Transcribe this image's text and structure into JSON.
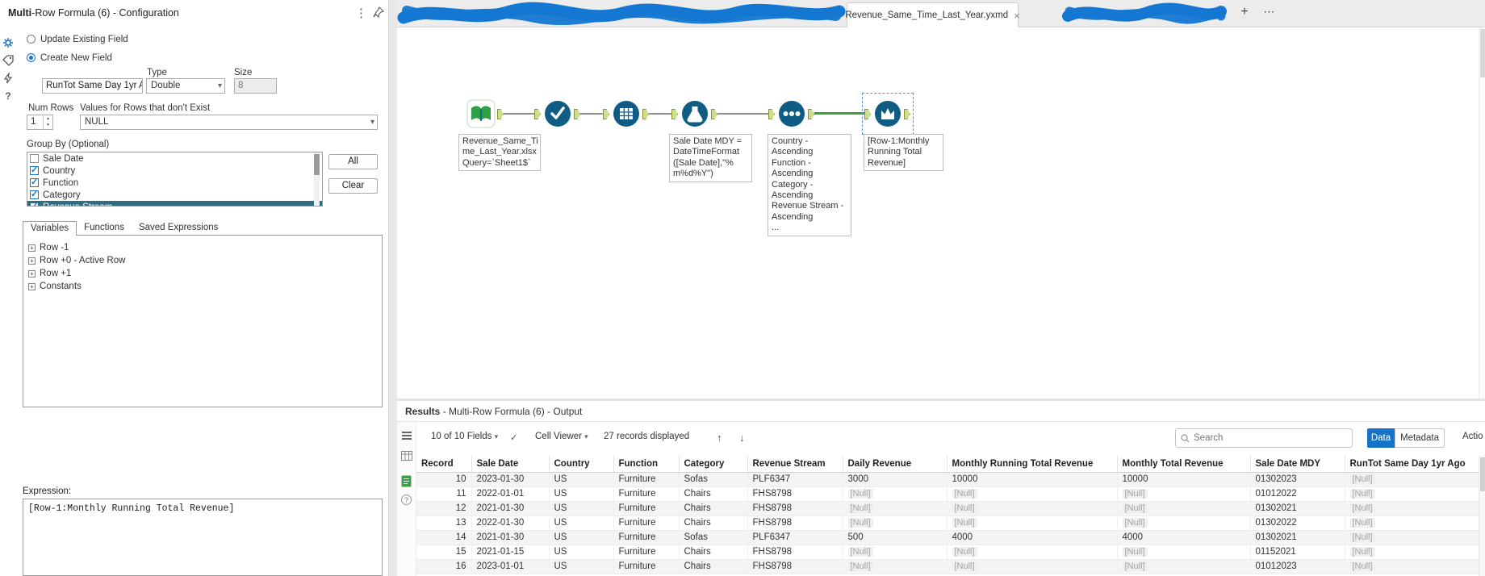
{
  "icons": {
    "kebab": "⋮",
    "caret": "▾",
    "close": "×",
    "add": "+",
    "more": "⋯",
    "up": "↑",
    "down": "↓",
    "check": "✓",
    "question": "?",
    "expand": "+",
    "spin_up": "▲",
    "spin_down": "▼"
  },
  "colors": {
    "accent_blue": "#1673c8",
    "tool_circle": "#0f5c84",
    "anchor_green": "#cdde8f",
    "connection_green": "#3da23d",
    "redaction_blue": "#1478d2"
  },
  "config": {
    "title_bold": "Multi",
    "title_rest": "-Row Formula (6) - Configuration",
    "radio_update": "Update Existing Field",
    "radio_create": "Create New  Field",
    "field_value": "RunTot Same Day 1yr A",
    "type_label": "Type",
    "type_value": "Double",
    "size_label": "Size",
    "size_value": "8",
    "num_rows_label": "Num Rows",
    "num_rows_value": "1",
    "values_label": "Values for Rows that don't Exist",
    "values_value": "NULL",
    "group_by": {
      "label": "Group By (Optional)",
      "items": [
        {
          "label": "Sale Date",
          "checked": false
        },
        {
          "label": "Country",
          "checked": true
        },
        {
          "label": "Function",
          "checked": true
        },
        {
          "label": "Category",
          "checked": true
        },
        {
          "label": "Revenue Stream",
          "checked": true
        }
      ],
      "all": "All",
      "clear": "Clear"
    },
    "tabs": [
      {
        "label": "Variables"
      },
      {
        "label": "Functions"
      },
      {
        "label": "Saved Expressions"
      }
    ],
    "variables_tree": [
      "Row -1",
      "Row +0 - Active Row",
      "Row +1",
      "Constants"
    ],
    "expression_label": "Expression:",
    "expression_value": "[Row-1:Monthly Running Total Revenue]"
  },
  "workflow_tabs": {
    "active": "Revenue_Same_Time_Last_Year.yxmd"
  },
  "canvas": {
    "tools": [
      {
        "id": "input-data",
        "annotation": "Revenue_Same_Ti\nme_Last_Year.xlsx\nQuery=`Sheet1$`"
      },
      {
        "id": "select",
        "annotation": ""
      },
      {
        "id": "datetime",
        "annotation": ""
      },
      {
        "id": "formula",
        "annotation": "Sale Date MDY =\nDateTimeFormat\n([Sale Date],\"%\nm%d%Y\")"
      },
      {
        "id": "sort",
        "annotation": "Country -\nAscending\nFunction -\nAscending\nCategory -\nAscending\nRevenue Stream -\nAscending\n..."
      },
      {
        "id": "multi-row-formula",
        "annotation": "[Row-1:Monthly\nRunning Total\nRevenue]"
      }
    ]
  },
  "results": {
    "title_bold": "Results",
    "title_rest": " - Multi-Row Formula (6) - Output",
    "toolbar": {
      "fields": "10 of 10 Fields",
      "cell_viewer": "Cell Viewer",
      "records": "27 records displayed",
      "search_placeholder": "Search",
      "data": "Data",
      "metadata": "Metadata",
      "actions": "Actio"
    },
    "columns": [
      "Record",
      "Sale Date",
      "Country",
      "Function",
      "Category",
      "Revenue Stream",
      "Daily Revenue",
      "Monthly Running Total Revenue",
      "Monthly Total Revenue",
      "Sale Date MDY",
      "RunTot Same Day 1yr Ago"
    ],
    "rows": [
      [
        "10",
        "2023-01-30",
        "US",
        "Furniture",
        "Sofas",
        "PLF6347",
        "3000",
        "10000",
        "10000",
        "01302023",
        "[Null]"
      ],
      [
        "11",
        "2022-01-01",
        "US",
        "Furniture",
        "Chairs",
        "FHS8798",
        "[Null]",
        "[Null]",
        "[Null]",
        "01012022",
        "[Null]"
      ],
      [
        "12",
        "2021-01-30",
        "US",
        "Furniture",
        "Chairs",
        "FHS8798",
        "[Null]",
        "[Null]",
        "[Null]",
        "01302021",
        "[Null]"
      ],
      [
        "13",
        "2022-01-30",
        "US",
        "Furniture",
        "Chairs",
        "FHS8798",
        "[Null]",
        "[Null]",
        "[Null]",
        "01302022",
        "[Null]"
      ],
      [
        "14",
        "2021-01-30",
        "US",
        "Furniture",
        "Sofas",
        "PLF6347",
        "500",
        "4000",
        "4000",
        "01302021",
        "[Null]"
      ],
      [
        "15",
        "2021-01-15",
        "US",
        "Furniture",
        "Chairs",
        "FHS8798",
        "[Null]",
        "[Null]",
        "[Null]",
        "01152021",
        "[Null]"
      ],
      [
        "16",
        "2023-01-01",
        "US",
        "Furniture",
        "Chairs",
        "FHS8798",
        "[Null]",
        "[Null]",
        "[Null]",
        "01012023",
        "[Null]"
      ]
    ]
  }
}
